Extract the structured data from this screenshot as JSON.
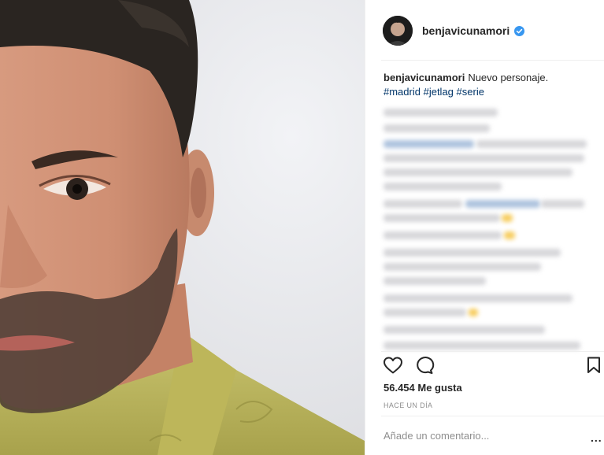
{
  "post": {
    "username": "benjavicunamori",
    "caption_text": "Nuevo personaje.",
    "hashtags": [
      "#madrid",
      "#jetlag",
      "#serie"
    ],
    "likes": "56.454 Me gusta",
    "timestamp": "HACE UN DÍA",
    "comment_placeholder": "Añade un comentario...",
    "more_options": "..."
  },
  "icons": {
    "verified": "verified-badge-icon",
    "like": "heart-icon",
    "comment": "comment-bubble-icon",
    "save": "bookmark-icon"
  },
  "colors": {
    "hashtag": "#003569",
    "verified": "#3897f0",
    "muted_text": "#8e8e8e"
  }
}
